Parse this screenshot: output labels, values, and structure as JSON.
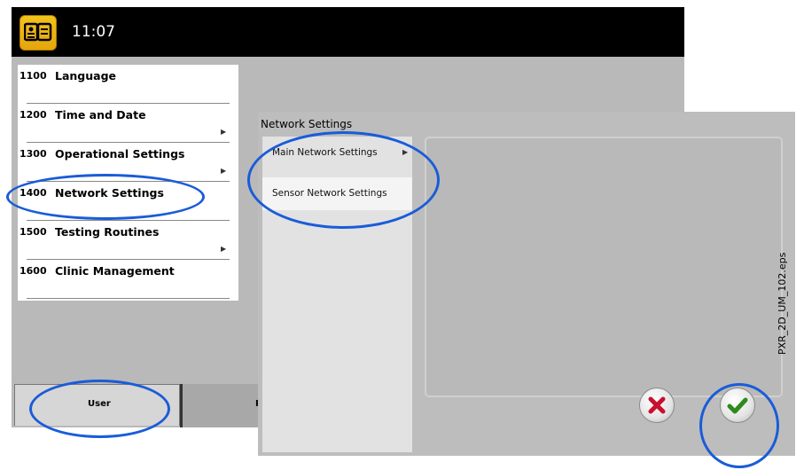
{
  "header": {
    "time": "11:07",
    "app_icon": "operator-id-card-icon"
  },
  "menu": {
    "items": [
      {
        "code": "1100",
        "label": "Language",
        "has_submenu": false
      },
      {
        "code": "1200",
        "label": "Time and Date",
        "has_submenu": true
      },
      {
        "code": "1300",
        "label": "Operational Settings",
        "has_submenu": true
      },
      {
        "code": "1400",
        "label": "Network Settings",
        "has_submenu": false
      },
      {
        "code": "1500",
        "label": "Testing Routines",
        "has_submenu": true
      },
      {
        "code": "1600",
        "label": "Clinic Management",
        "has_submenu": false
      }
    ]
  },
  "tabs": {
    "user": "User",
    "second_partial": "Pr"
  },
  "dialog": {
    "title": "Network Settings",
    "items": [
      {
        "label": "Main Network Settings",
        "has_submenu": true
      },
      {
        "label": "Sensor Network Settings",
        "has_submenu": false
      }
    ],
    "cancel_icon": "x-icon",
    "ok_icon": "checkmark-icon"
  },
  "figure_label": "PXR_2D_UM_102.eps",
  "colors": {
    "highlight": "#1a5cd8",
    "cancel": "#c8102e",
    "ok": "#2e8b1e"
  }
}
